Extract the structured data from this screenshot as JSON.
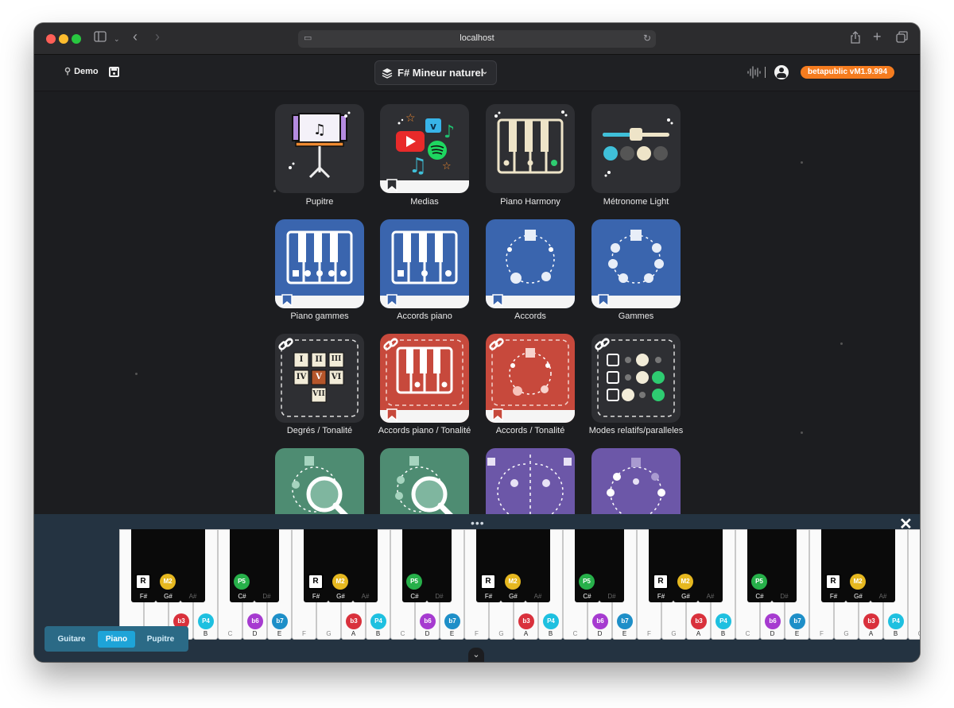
{
  "browser": {
    "url": "localhost"
  },
  "header": {
    "demo_label": "Demo",
    "key_label": "F# Mineur naturel",
    "version_label": "betapublic vM1.9.994",
    "colors": {
      "accent": "#f57c1f"
    }
  },
  "tiles": [
    {
      "label": "Pupitre"
    },
    {
      "label": "Medias"
    },
    {
      "label": "Piano Harmony"
    },
    {
      "label": "Métronome Light"
    },
    {
      "label": "Piano gammes"
    },
    {
      "label": "Accords piano"
    },
    {
      "label": "Accords"
    },
    {
      "label": "Gammes"
    },
    {
      "label": "Degrés / Tonalité"
    },
    {
      "label": "Accords piano / Tonalité"
    },
    {
      "label": "Accords / Tonalité"
    },
    {
      "label": "Modes relatifs/paralleles"
    }
  ],
  "degrees_grid": [
    "I",
    "II",
    "III",
    "IV",
    "V",
    "VI",
    "VII"
  ],
  "piano": {
    "white_keys": [
      "F",
      "G",
      "A",
      "B",
      "C",
      "D",
      "E",
      "F",
      "G",
      "A",
      "B",
      "C",
      "D",
      "E",
      "F",
      "G",
      "A",
      "B",
      "C",
      "D",
      "E",
      "F",
      "G",
      "A",
      "B",
      "C",
      "D",
      "E",
      "F",
      "G",
      "A",
      "B",
      "C"
    ],
    "black_labels": [
      "C#",
      "D#",
      "F#",
      "G#",
      "A#"
    ],
    "badges": {
      "P5": "P5",
      "R": "R",
      "M2": "M2",
      "b6": "b6",
      "b7": "b7",
      "b3": "b3",
      "P4": "P4"
    },
    "colors": {
      "P5": "#27b04a",
      "R": "#ffffff",
      "M2": "#e6b820",
      "b6": "#a63bd0",
      "b7": "#1e8fc8",
      "b3": "#d9313c",
      "P4": "#1ec0e0"
    }
  },
  "tabs": [
    {
      "label": "Guitare"
    },
    {
      "label": "Piano"
    },
    {
      "label": "Pupitre"
    }
  ]
}
